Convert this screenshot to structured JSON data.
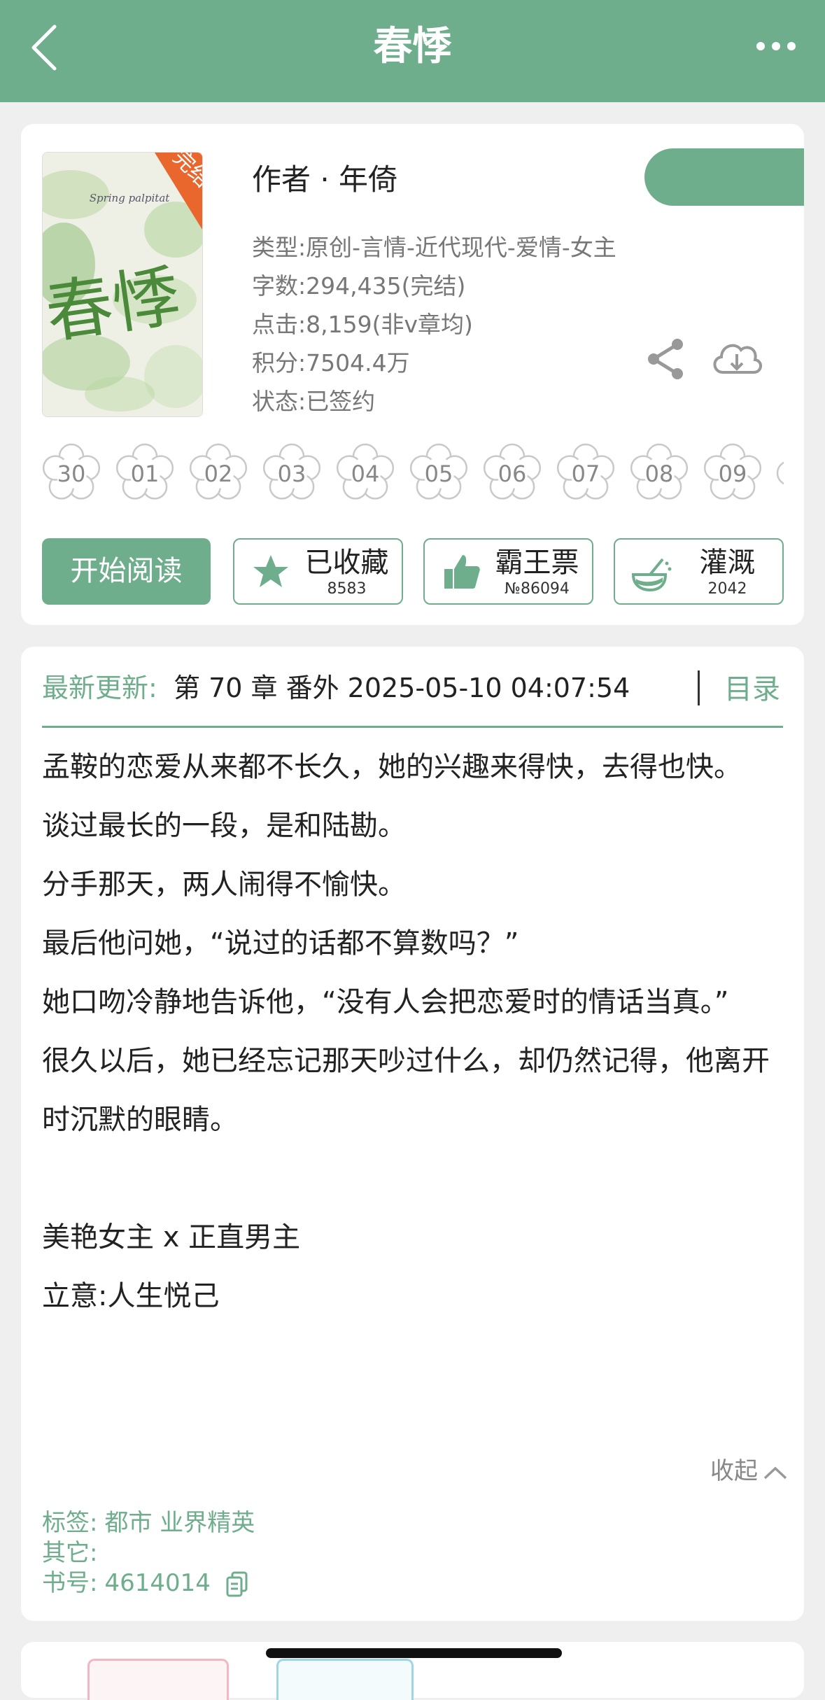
{
  "header": {
    "title": "春悸",
    "back_icon": "chevron-left-icon",
    "more_icon": "more-dots-icon",
    "color": "#6fae8c"
  },
  "book": {
    "cover_title": "春悸",
    "cover_subtitle": "Spring palpitat",
    "cover_badge": "完结",
    "author": "作者 · 年倚",
    "type": "类型:原创-言情-近代现代-爱情-女主",
    "word_count": "字数:294,435(完结)",
    "clicks": "点击:8,159(非v章均)",
    "score": "积分:7504.4万",
    "status": "状态:已签约"
  },
  "chapters": [
    "30",
    "01",
    "02",
    "03",
    "04",
    "05",
    "06",
    "07",
    "08",
    "09"
  ],
  "actions": {
    "read": "开始阅读",
    "collect_label": "已收藏",
    "collect_count": "8583",
    "ticket_label": "霸王票",
    "ticket_count": "№86094",
    "water_label": "灌溉",
    "water_count": "2042"
  },
  "update": {
    "label": "最新更新:",
    "chapter": "第 70 章 番外 2025-05-10 04:07:54",
    "toc": "目录"
  },
  "intro": {
    "p1": "孟鞍的恋爱从来都不长久，她的兴趣来得快，去得也快。",
    "p2": "谈过最长的一段，是和陆勘。",
    "p3": "分手那天，两人闹得不愉快。",
    "p4": "最后他问她，“说过的话都不算数吗？”",
    "p5": "她口吻冷静地告诉他，“没有人会把恋爱时的情话当真。”",
    "p6": "很久以后，她已经忘记那天吵过什么，却仍然记得，他离开时沉默的眼睛。",
    "p7": "美艳女主 x 正直男主",
    "p8": "立意:人生悦己"
  },
  "collapse": "收起",
  "tags": {
    "label": "标签:",
    "value": "都市  业界精英",
    "other_label": "其它:",
    "id_label": "书号:",
    "id_value": "4614014"
  }
}
